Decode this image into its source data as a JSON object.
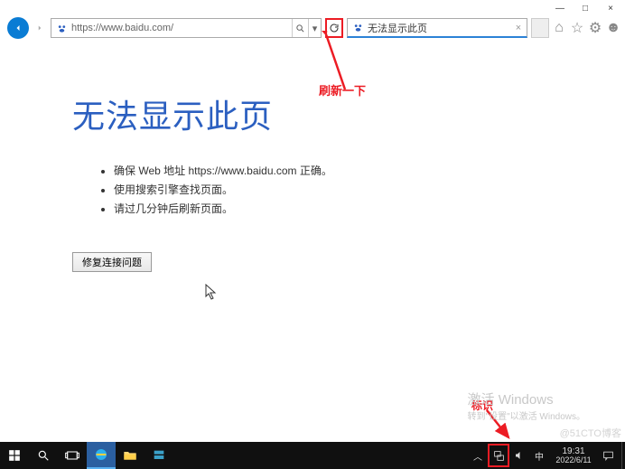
{
  "titlebar": {
    "minimize": "—",
    "maximize": "□",
    "close": "×"
  },
  "address": {
    "url": "https://www.baidu.com/",
    "search_icon": "search",
    "dropdown": "▾",
    "refresh": "↻"
  },
  "tab": {
    "title": "无法显示此页",
    "close": "×"
  },
  "toolbar": {
    "home": "⌂",
    "fav": "☆",
    "gear": "⚙",
    "smile": "☻"
  },
  "page": {
    "title": "无法显示此页",
    "bullets": [
      "确保 Web 地址 https://www.baidu.com 正确。",
      "使用搜索引擎查找页面。",
      "请过几分钟后刷新页面。"
    ],
    "fix_button": "修复连接问题"
  },
  "annotations": {
    "refresh_hint": "刷新一下",
    "tray_hint": "标识"
  },
  "watermark": {
    "title": "激活 Windows",
    "sub": "转到\"设置\"以激活 Windows。",
    "blog": "@51CTO博客"
  },
  "taskbar": {
    "chev": "︿",
    "net": "⧉",
    "ime": "中",
    "time": "19:31",
    "date": "2022/6/11",
    "notif": "💬"
  }
}
